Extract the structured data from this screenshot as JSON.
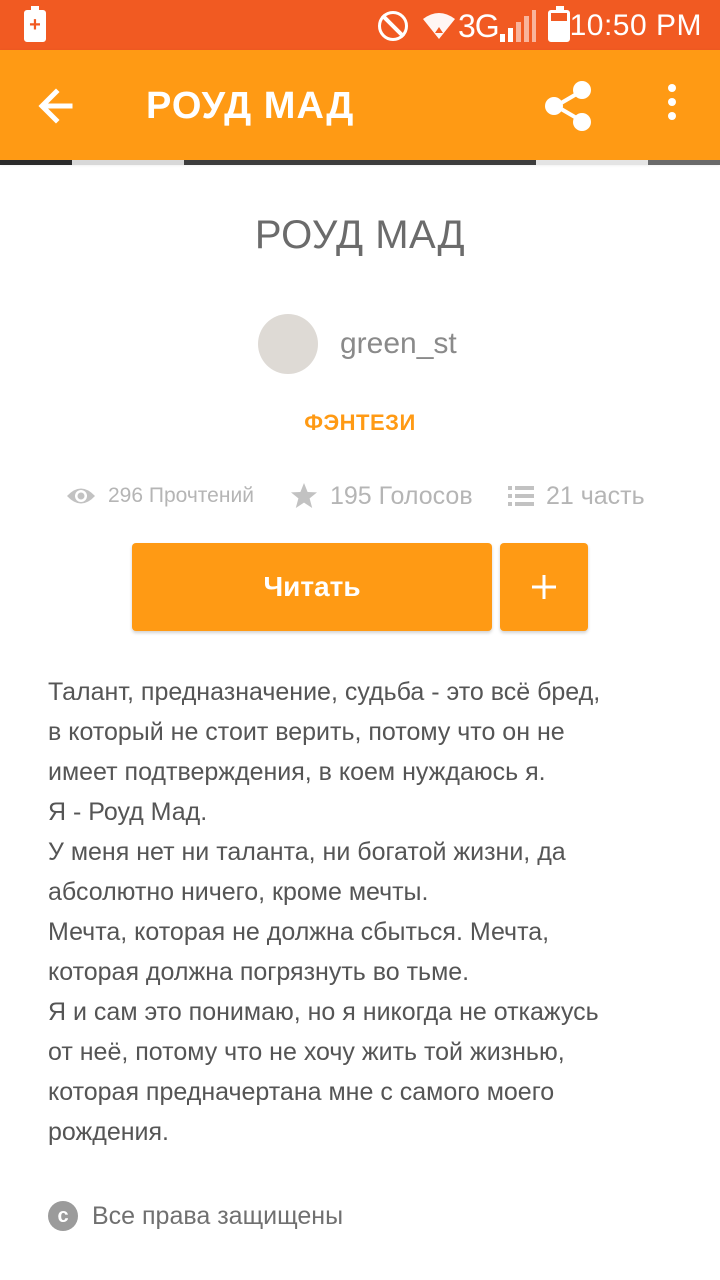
{
  "status_bar": {
    "network_type": "3G",
    "time": "10:50 PM",
    "battery_alert_glyph": "+",
    "icons": [
      "battery-alert-icon",
      "do-not-disturb-icon",
      "wifi-icon",
      "signal-icon",
      "battery-icon"
    ]
  },
  "app_bar": {
    "title": "РОУД МАД",
    "icons": [
      "back-arrow-icon",
      "share-icon",
      "more-vert-icon"
    ]
  },
  "story": {
    "title": "РОУД МАД",
    "author": "green_st",
    "genre": "ФЭНТЕЗИ",
    "stats": {
      "reads": "296 Прочтений",
      "votes": "195 Голосов",
      "parts": "21 часть"
    },
    "read_button": "Читать",
    "add_button": "+",
    "description": [
      "Талант, предназначение, судьба - это всё бред,",
      "в который не стоит верить, потому что он не",
      "имеет подтверждения, в коем нуждаюсь я.",
      "Я - Роуд Мад.",
      "У меня нет ни таланта, ни богатой жизни, да",
      "абсолютно ничего, кроме мечты.",
      "Мечта, которая не должна сбыться. Мечта,",
      "которая должна погрязнуть во тьме.",
      "Я и сам это понимаю, но я никогда не откажусь",
      "от неё, потому что не хочу  жить той жизнью,",
      "которая предначертана мне с самого моего",
      "рождения."
    ],
    "copyright_glyph": "c",
    "copyright": "Все права защищены"
  },
  "colors": {
    "status_bar": "#f15a22",
    "accent": "#ff9a14",
    "title_text": "#6b6b6b",
    "meta_text": "#b5b5b5",
    "body_text": "#555555"
  }
}
